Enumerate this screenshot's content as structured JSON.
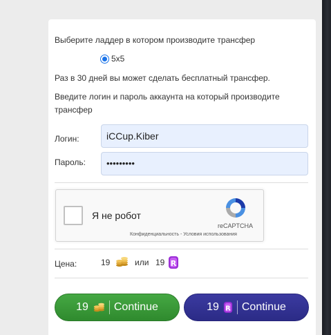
{
  "form": {
    "ladder_prompt": "Выберите ладдер в котором производите трансфер",
    "ladder_option": "5x5",
    "free_transfer_note": "Раз в 30 дней вы может сделать бесплатный трансфер.",
    "credentials_prompt_line1": "Введите логин и пароль аккаунта на который производите",
    "credentials_prompt_line2": "трансфер",
    "login_label": "Логин:",
    "login_value": "iCCup.Kiber",
    "password_label": "Пароль:",
    "password_value": "•••••••••"
  },
  "captcha": {
    "label": "Я не робот",
    "brand": "reCAPTCHA",
    "privacy": "Конфиденциальность",
    "sep": " - ",
    "terms": "Условия использования"
  },
  "price": {
    "label": "Цена:",
    "gold_amount": "19",
    "or": "или",
    "crystal_amount": "19"
  },
  "buttons": {
    "gold_amount": "19",
    "gold_label": "Continue",
    "crystal_amount": "19",
    "crystal_label": "Continue"
  },
  "colors": {
    "green_button": "#2f8a2e",
    "purple_button": "#2b2b86",
    "field_bg": "#e8f0fe"
  },
  "icons": {
    "gold": "gold-coins-icon",
    "crystal": "purple-crystal-icon",
    "recaptcha": "recaptcha-logo-icon"
  }
}
